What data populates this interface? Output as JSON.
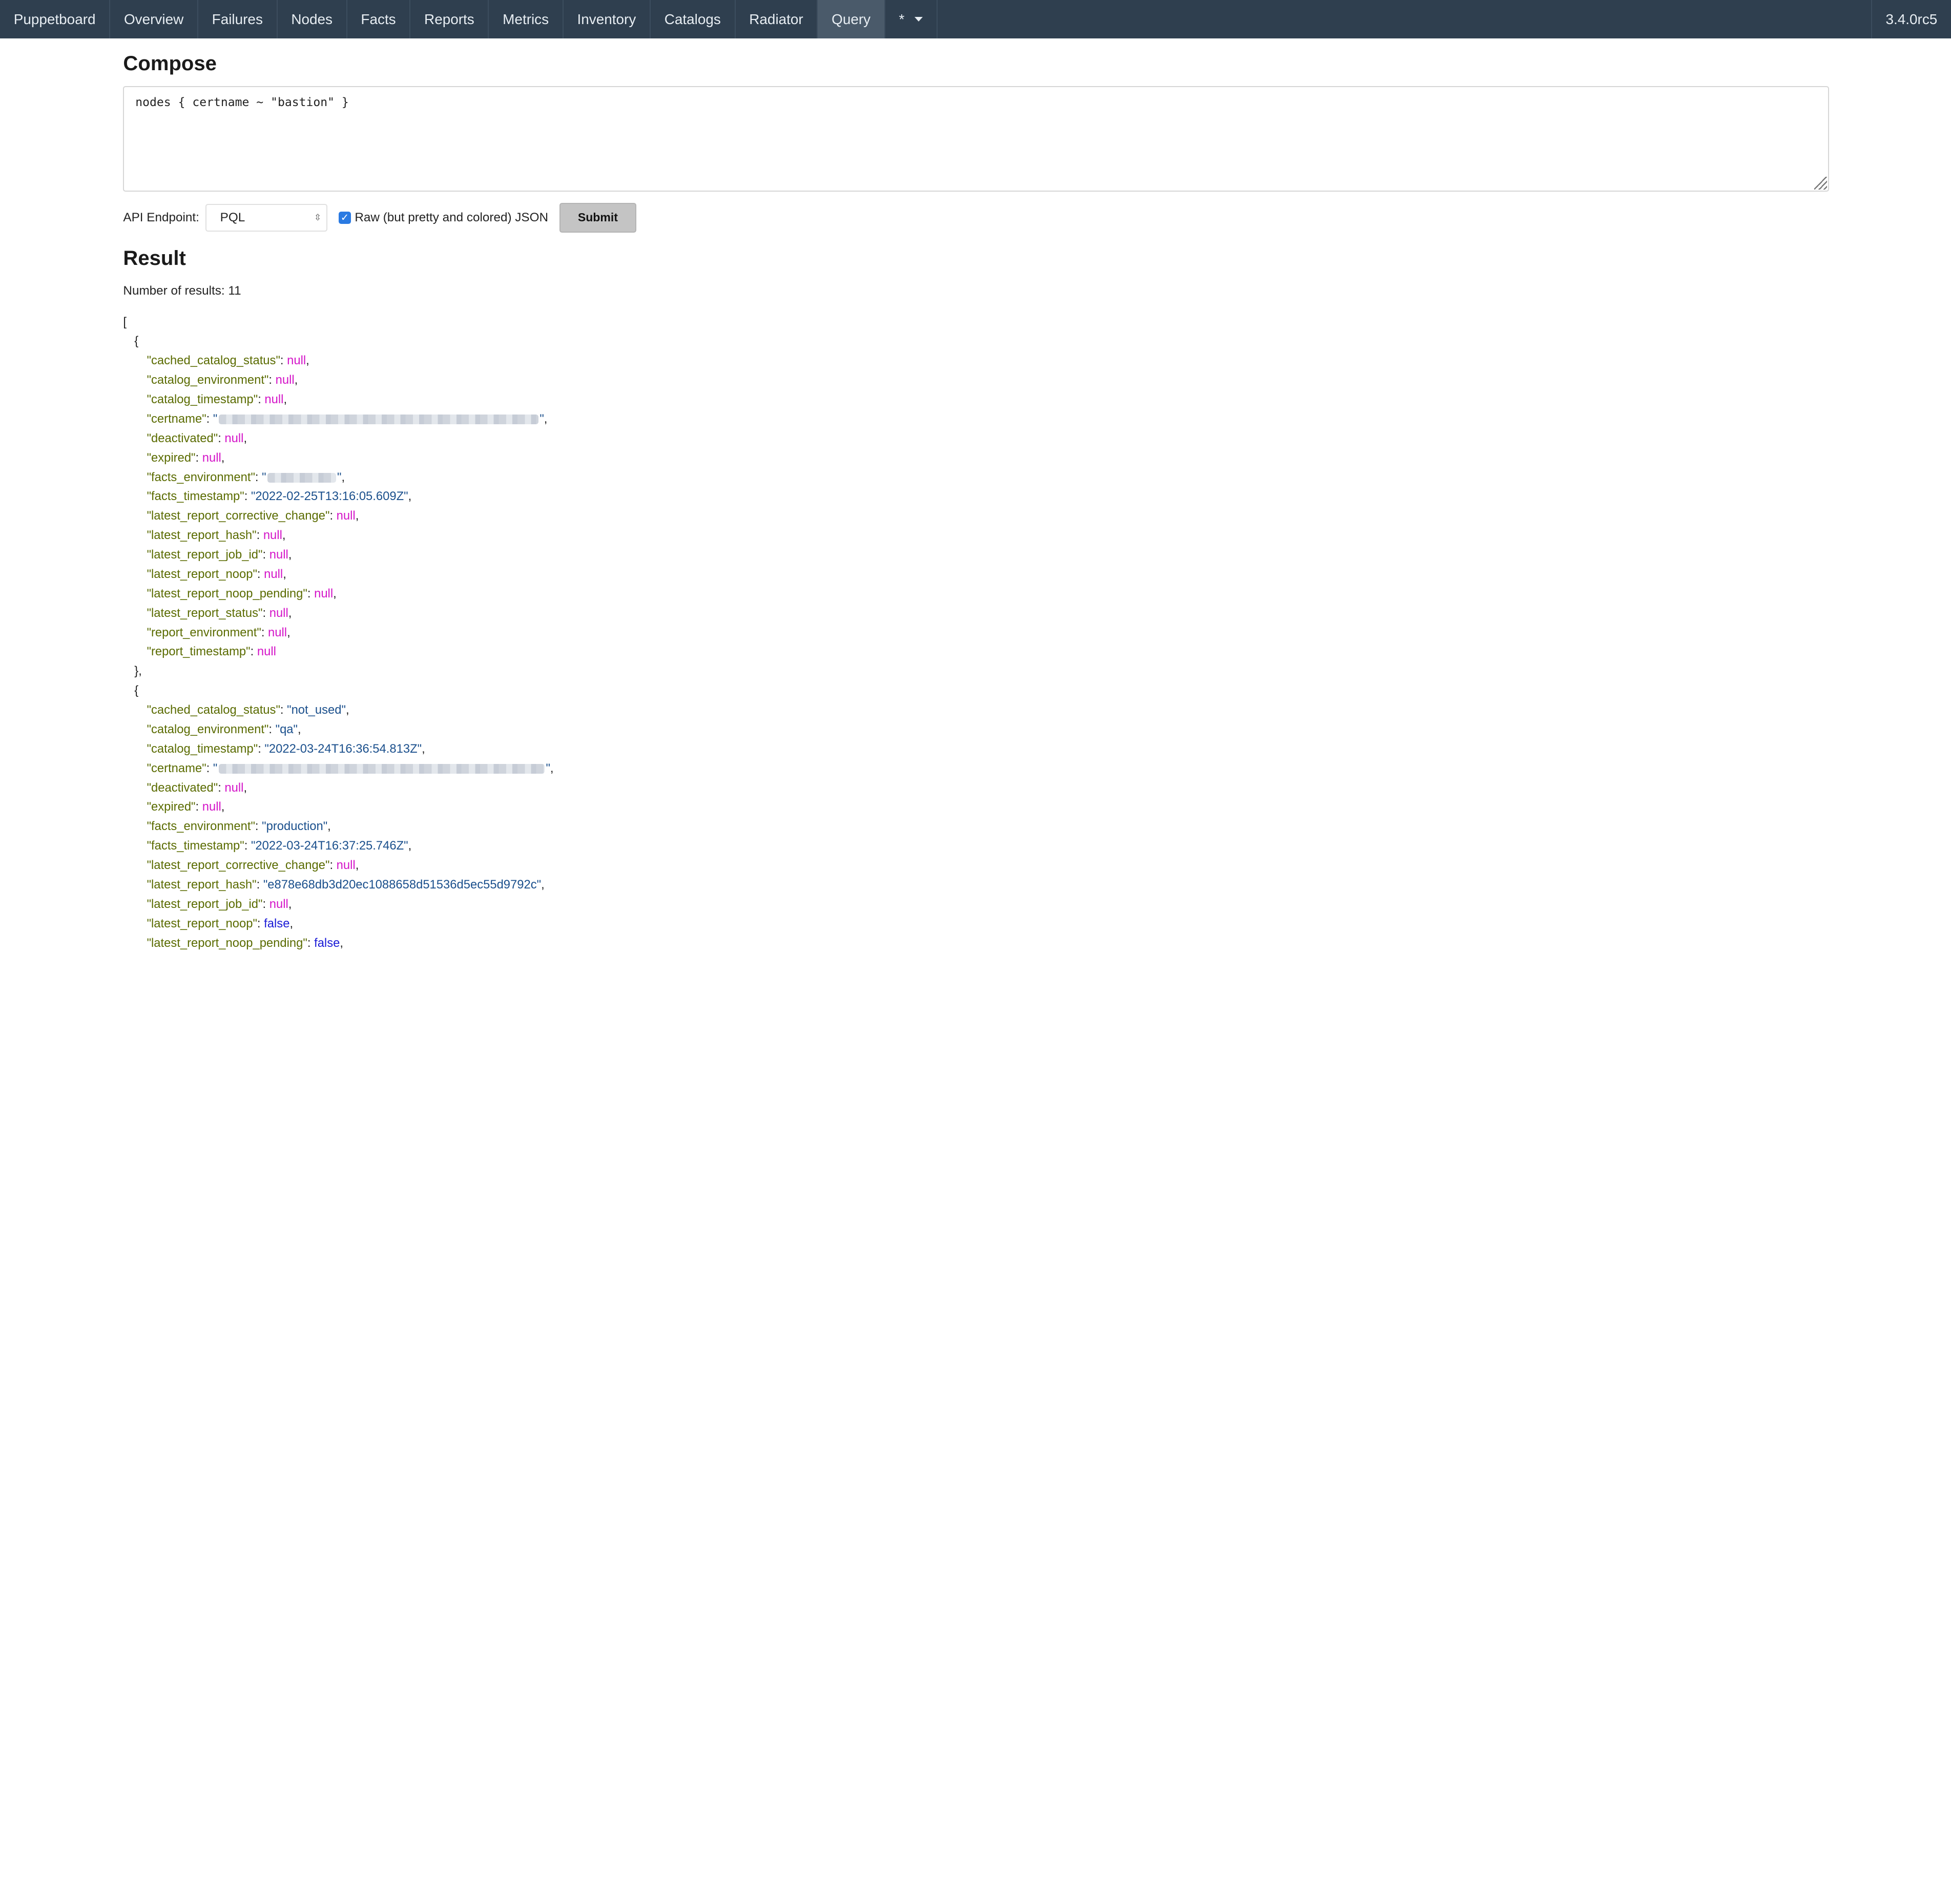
{
  "nav": {
    "items": [
      "Puppetboard",
      "Overview",
      "Failures",
      "Nodes",
      "Facts",
      "Reports",
      "Metrics",
      "Inventory",
      "Catalogs",
      "Radiator",
      "Query"
    ],
    "more": "*",
    "version": "3.4.0rc5"
  },
  "compose": {
    "title": "Compose",
    "query": "nodes { certname ~ \"bastion\" }"
  },
  "controls": {
    "endpoint_label": "API Endpoint:",
    "endpoint_value": "PQL",
    "raw_label": "Raw (but pretty and colored) JSON",
    "raw_checked": true,
    "submit_label": "Submit"
  },
  "result": {
    "title": "Result",
    "count_text": "Number of results: 11"
  },
  "records": [
    {
      "cached_catalog_status": null,
      "catalog_environment": null,
      "catalog_timestamp": null,
      "certname": "[redacted]",
      "deactivated": null,
      "expired": null,
      "facts_environment": "[redacted]",
      "facts_timestamp": "2022-02-25T13:16:05.609Z",
      "latest_report_corrective_change": null,
      "latest_report_hash": null,
      "latest_report_job_id": null,
      "latest_report_noop": null,
      "latest_report_noop_pending": null,
      "latest_report_status": null,
      "report_environment": null,
      "report_timestamp": null
    },
    {
      "cached_catalog_status": "not_used",
      "catalog_environment": "qa",
      "catalog_timestamp": "2022-03-24T16:36:54.813Z",
      "certname": "[redacted]",
      "deactivated": null,
      "expired": null,
      "facts_environment": "production",
      "facts_timestamp": "2022-03-24T16:37:25.746Z",
      "latest_report_corrective_change": null,
      "latest_report_hash": "e878e68db3d20ec1088658d51536d5ec55d9792c",
      "latest_report_job_id": null,
      "latest_report_noop": false,
      "latest_report_noop_pending": false
    }
  ],
  "colors": {
    "navbar": "#2f3f4f",
    "key": "#5a6b00",
    "null": "#d414c8",
    "string": "#1a4f8c",
    "boolean": "#1a1ad6"
  }
}
